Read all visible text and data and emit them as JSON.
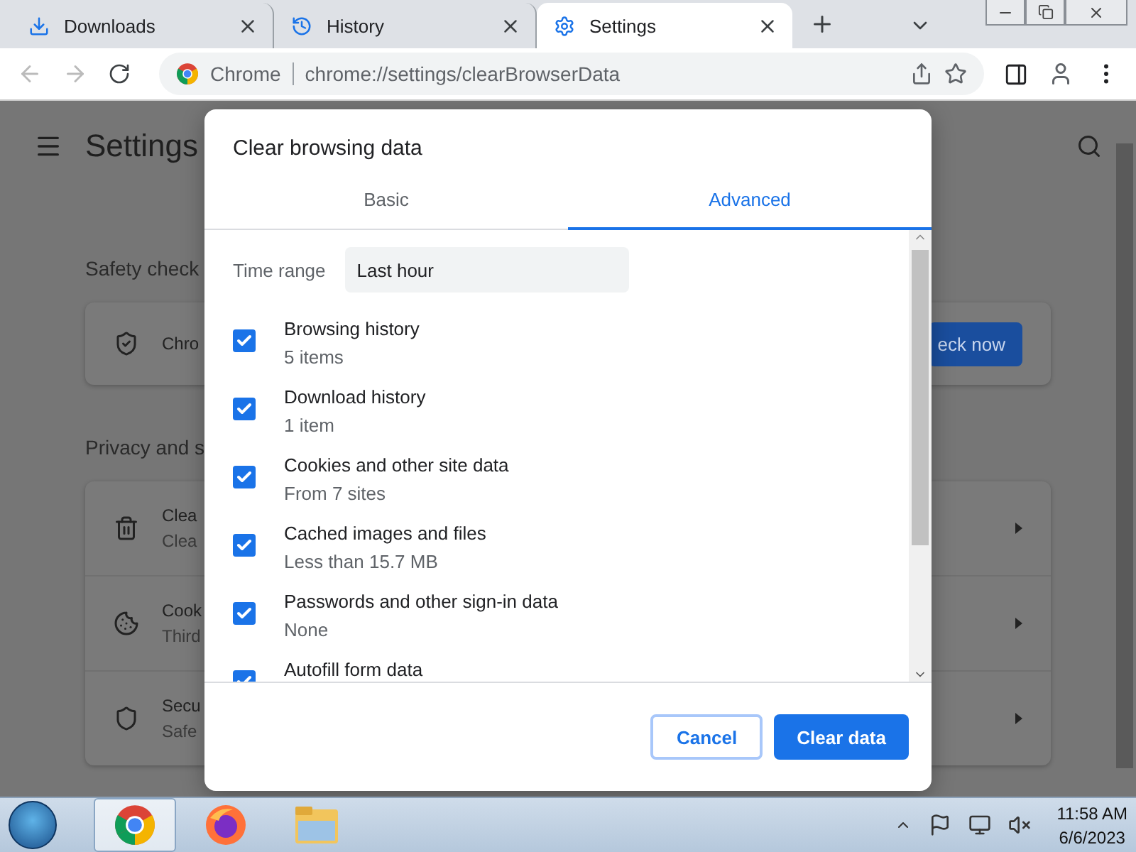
{
  "browser_tabs": [
    {
      "label": "Downloads",
      "selected": false
    },
    {
      "label": "History",
      "selected": false
    },
    {
      "label": "Settings",
      "selected": true
    }
  ],
  "address_bar": {
    "site_label": "Chrome",
    "url": "chrome://settings/clearBrowserData"
  },
  "settings_page": {
    "title": "Settings",
    "sections": [
      {
        "heading": "Safety check",
        "rows": [
          {
            "title": "Chro",
            "action": "eck now"
          }
        ]
      },
      {
        "heading": "Privacy and s",
        "rows": [
          {
            "title": "Clea",
            "subtitle": "Clea"
          },
          {
            "title": "Cook",
            "subtitle": "Third"
          },
          {
            "title": "Secu",
            "subtitle": "Safe"
          }
        ]
      }
    ]
  },
  "dialog": {
    "title": "Clear browsing data",
    "tabs": [
      {
        "label": "Basic",
        "selected": false
      },
      {
        "label": "Advanced",
        "selected": true
      }
    ],
    "time_range": {
      "label": "Time range",
      "value": "Last hour"
    },
    "items": [
      {
        "title": "Browsing history",
        "subtitle": "5 items",
        "checked": true
      },
      {
        "title": "Download history",
        "subtitle": "1 item",
        "checked": true
      },
      {
        "title": "Cookies and other site data",
        "subtitle": "From 7 sites",
        "checked": true
      },
      {
        "title": "Cached images and files",
        "subtitle": "Less than 15.7 MB",
        "checked": true
      },
      {
        "title": "Passwords and other sign-in data",
        "subtitle": "None",
        "checked": true
      },
      {
        "title": "Autofill form data",
        "checked": true
      }
    ],
    "buttons": [
      {
        "label": "Cancel",
        "kind": "secondary"
      },
      {
        "label": "Clear data",
        "kind": "primary"
      }
    ]
  },
  "taskbar": {
    "apps": [
      {
        "selected": true
      },
      {
        "selected": false
      },
      {
        "selected": false
      }
    ],
    "time": "11:58 AM",
    "date": "6/6/2023"
  }
}
